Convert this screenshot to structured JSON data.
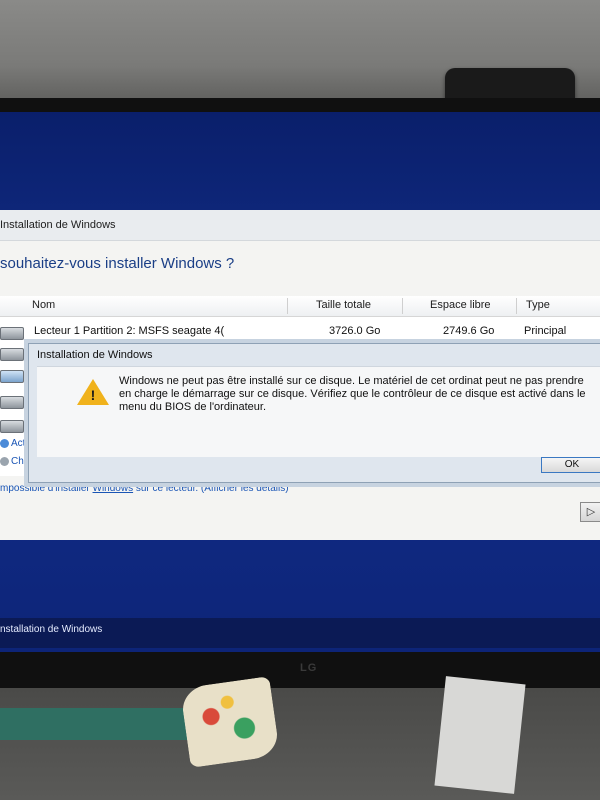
{
  "installer": {
    "title": "Installation de Windows",
    "heading": "souhaitez-vous installer Windows ?",
    "columns": {
      "name": "Nom",
      "total": "Taille totale",
      "free": "Espace libre",
      "type": "Type"
    },
    "rows": [
      {
        "name": "Lecteur 1 Partition 2: MSFS seagate 4(",
        "total": "3726.0 Go",
        "free": "2749.6 Go",
        "type": "Principal"
      }
    ],
    "links": {
      "refresh": "Act",
      "load_driver": "Cha"
    },
    "error_prefix": "mpossible d'installer ",
    "error_link": "Windows",
    "error_suffix": " sur ce lecteur. (Afficher les détails)",
    "next_label": "▷"
  },
  "dialog": {
    "title": "Installation de Windows",
    "message": "Windows ne peut pas être installé sur ce disque. Le matériel de cet ordinat peut ne pas prendre en charge le démarrage sur ce disque. Vérifiez que le contrôleur de ce disque est activé dans le menu du BIOS de l'ordinateur.",
    "ok_label": "OK"
  },
  "taskbar": {
    "label": "nstallation de Windows"
  },
  "monitor": {
    "brand": "LG"
  },
  "colors": {
    "screen_blue": "#13308c",
    "heading_blue": "#1a3e86",
    "link_blue": "#1a55b5",
    "warning": "#f0b21c"
  }
}
